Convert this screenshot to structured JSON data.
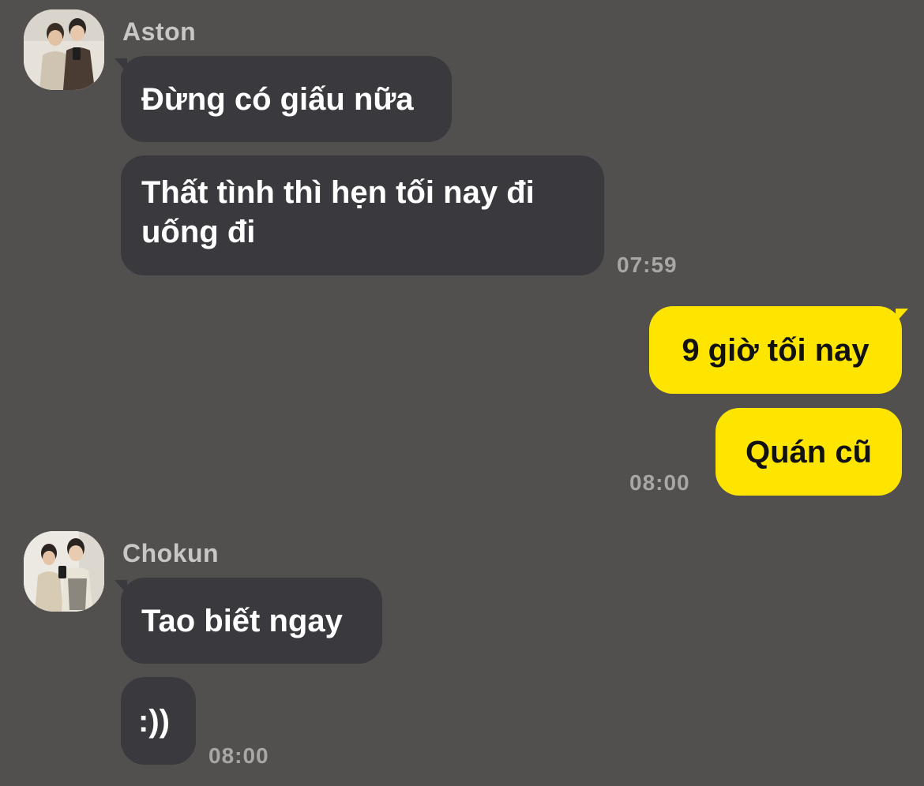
{
  "messages": {
    "aston": {
      "name": "Aston",
      "avatar_icon": "profile-photo-two-people",
      "lines": [
        "Đừng có giấu nữa",
        "Thất tình thì hẹn tối nay đi uống đi"
      ],
      "time": "07:59"
    },
    "me": {
      "lines": [
        "9 giờ tối nay",
        "Quán cũ"
      ],
      "time": "08:00"
    },
    "chokun": {
      "name": "Chokun",
      "avatar_icon": "profile-photo-two-people",
      "lines": [
        "Tao biết ngay",
        ":))"
      ],
      "time": "08:00"
    }
  },
  "colors": {
    "background": "#524f4f",
    "incoming_bubble": "#3a393d",
    "outgoing_bubble": "#fee500"
  }
}
